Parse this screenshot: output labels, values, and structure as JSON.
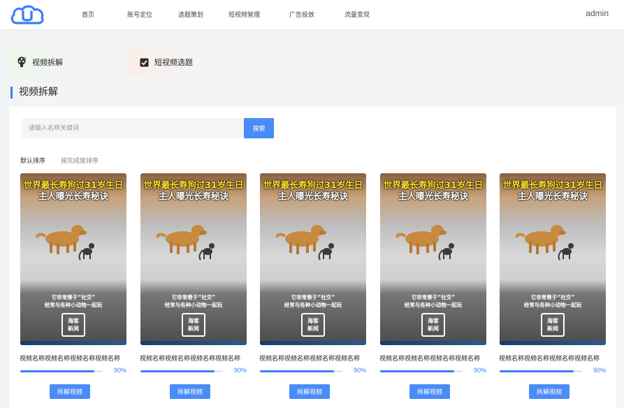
{
  "nav": {
    "items": [
      "首页",
      "账号定位",
      "选题策划",
      "短视频管理",
      "广告投放",
      "流量变现"
    ],
    "user": "admin"
  },
  "modules": {
    "tab1": "视频拆解",
    "tab2": "短视频选题"
  },
  "section_title": "视频拆解",
  "search": {
    "placeholder": "请输入名称关键词",
    "button": "搜索"
  },
  "sort": {
    "default": "默认排序",
    "by_completion": "按完成度排序"
  },
  "cards": [
    {
      "headline1": "世界最长寿狗过31岁生日",
      "headline2": "主人曝光长寿秘诀",
      "caption1": "它非常善于“社交”",
      "caption2": "经常与各种小动物一起玩",
      "stamp": "海客新闻",
      "name": "视频名称视频名称视频名称视频名称",
      "progress": 90,
      "progress_label": "90%",
      "action": "拆解视频"
    },
    {
      "headline1": "世界最长寿狗过31岁生日",
      "headline2": "主人曝光长寿秘诀",
      "caption1": "它非常善于“社交”",
      "caption2": "经常与各种小动物一起玩",
      "stamp": "海客新闻",
      "name": "视频名称视频名称视频名称视频名称",
      "progress": 90,
      "progress_label": "90%",
      "action": "拆解视频"
    },
    {
      "headline1": "世界最长寿狗过31岁生日",
      "headline2": "主人曝光长寿秘诀",
      "caption1": "它非常善于“社交”",
      "caption2": "经常与各种小动物一起玩",
      "stamp": "海客新闻",
      "name": "视频名称视频名称视频名称视频名称",
      "progress": 90,
      "progress_label": "90%",
      "action": "拆解视频"
    },
    {
      "headline1": "世界最长寿狗过31岁生日",
      "headline2": "主人曝光长寿秘诀",
      "caption1": "它非常善于“社交”",
      "caption2": "经常与各种小动物一起玩",
      "stamp": "海客新闻",
      "name": "视频名称视频名称视频名称视频名称",
      "progress": 90,
      "progress_label": "90%",
      "action": "拆解视频"
    },
    {
      "headline1": "世界最长寿狗过31岁生日",
      "headline2": "主人曝光长寿秘诀",
      "caption1": "它非常善于“社交”",
      "caption2": "经常与各种小动物一起玩",
      "stamp": "海客新闻",
      "name": "视频名称视频名称视频名称视频名称",
      "progress": 90,
      "progress_label": "90%",
      "action": "拆解视频"
    }
  ],
  "colors": {
    "accent": "#3b7ef6",
    "button": "#4a8cf7",
    "headline": "#ffe52b"
  },
  "icons": {
    "logo": "cloud-u-logo",
    "tab1": "film-reel-icon",
    "tab2": "checkbox-icon"
  }
}
